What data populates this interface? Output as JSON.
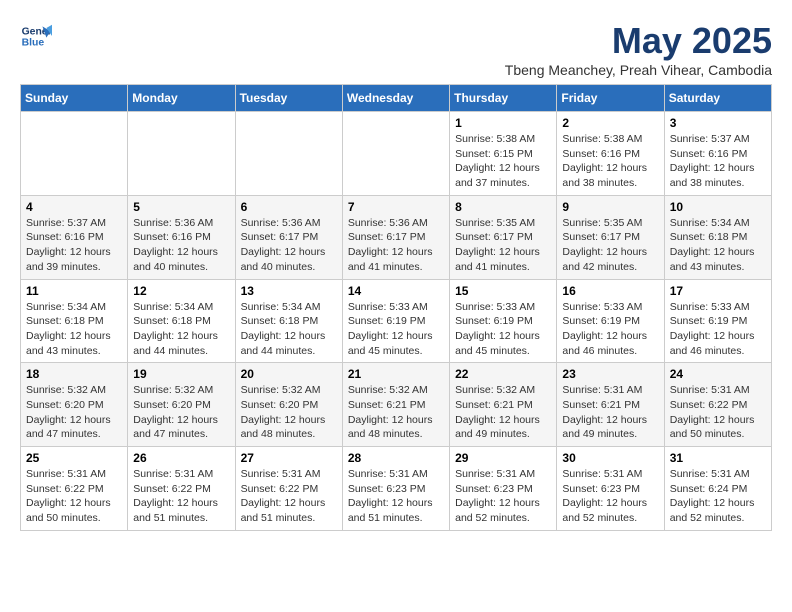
{
  "header": {
    "logo_line1": "General",
    "logo_line2": "Blue",
    "month_title": "May 2025",
    "subtitle": "Tbeng Meanchey, Preah Vihear, Cambodia"
  },
  "days_of_week": [
    "Sunday",
    "Monday",
    "Tuesday",
    "Wednesday",
    "Thursday",
    "Friday",
    "Saturday"
  ],
  "weeks": [
    [
      {
        "day": "",
        "info": ""
      },
      {
        "day": "",
        "info": ""
      },
      {
        "day": "",
        "info": ""
      },
      {
        "day": "",
        "info": ""
      },
      {
        "day": "1",
        "info": "Sunrise: 5:38 AM\nSunset: 6:15 PM\nDaylight: 12 hours\nand 37 minutes."
      },
      {
        "day": "2",
        "info": "Sunrise: 5:38 AM\nSunset: 6:16 PM\nDaylight: 12 hours\nand 38 minutes."
      },
      {
        "day": "3",
        "info": "Sunrise: 5:37 AM\nSunset: 6:16 PM\nDaylight: 12 hours\nand 38 minutes."
      }
    ],
    [
      {
        "day": "4",
        "info": "Sunrise: 5:37 AM\nSunset: 6:16 PM\nDaylight: 12 hours\nand 39 minutes."
      },
      {
        "day": "5",
        "info": "Sunrise: 5:36 AM\nSunset: 6:16 PM\nDaylight: 12 hours\nand 40 minutes."
      },
      {
        "day": "6",
        "info": "Sunrise: 5:36 AM\nSunset: 6:17 PM\nDaylight: 12 hours\nand 40 minutes."
      },
      {
        "day": "7",
        "info": "Sunrise: 5:36 AM\nSunset: 6:17 PM\nDaylight: 12 hours\nand 41 minutes."
      },
      {
        "day": "8",
        "info": "Sunrise: 5:35 AM\nSunset: 6:17 PM\nDaylight: 12 hours\nand 41 minutes."
      },
      {
        "day": "9",
        "info": "Sunrise: 5:35 AM\nSunset: 6:17 PM\nDaylight: 12 hours\nand 42 minutes."
      },
      {
        "day": "10",
        "info": "Sunrise: 5:34 AM\nSunset: 6:18 PM\nDaylight: 12 hours\nand 43 minutes."
      }
    ],
    [
      {
        "day": "11",
        "info": "Sunrise: 5:34 AM\nSunset: 6:18 PM\nDaylight: 12 hours\nand 43 minutes."
      },
      {
        "day": "12",
        "info": "Sunrise: 5:34 AM\nSunset: 6:18 PM\nDaylight: 12 hours\nand 44 minutes."
      },
      {
        "day": "13",
        "info": "Sunrise: 5:34 AM\nSunset: 6:18 PM\nDaylight: 12 hours\nand 44 minutes."
      },
      {
        "day": "14",
        "info": "Sunrise: 5:33 AM\nSunset: 6:19 PM\nDaylight: 12 hours\nand 45 minutes."
      },
      {
        "day": "15",
        "info": "Sunrise: 5:33 AM\nSunset: 6:19 PM\nDaylight: 12 hours\nand 45 minutes."
      },
      {
        "day": "16",
        "info": "Sunrise: 5:33 AM\nSunset: 6:19 PM\nDaylight: 12 hours\nand 46 minutes."
      },
      {
        "day": "17",
        "info": "Sunrise: 5:33 AM\nSunset: 6:19 PM\nDaylight: 12 hours\nand 46 minutes."
      }
    ],
    [
      {
        "day": "18",
        "info": "Sunrise: 5:32 AM\nSunset: 6:20 PM\nDaylight: 12 hours\nand 47 minutes."
      },
      {
        "day": "19",
        "info": "Sunrise: 5:32 AM\nSunset: 6:20 PM\nDaylight: 12 hours\nand 47 minutes."
      },
      {
        "day": "20",
        "info": "Sunrise: 5:32 AM\nSunset: 6:20 PM\nDaylight: 12 hours\nand 48 minutes."
      },
      {
        "day": "21",
        "info": "Sunrise: 5:32 AM\nSunset: 6:21 PM\nDaylight: 12 hours\nand 48 minutes."
      },
      {
        "day": "22",
        "info": "Sunrise: 5:32 AM\nSunset: 6:21 PM\nDaylight: 12 hours\nand 49 minutes."
      },
      {
        "day": "23",
        "info": "Sunrise: 5:31 AM\nSunset: 6:21 PM\nDaylight: 12 hours\nand 49 minutes."
      },
      {
        "day": "24",
        "info": "Sunrise: 5:31 AM\nSunset: 6:22 PM\nDaylight: 12 hours\nand 50 minutes."
      }
    ],
    [
      {
        "day": "25",
        "info": "Sunrise: 5:31 AM\nSunset: 6:22 PM\nDaylight: 12 hours\nand 50 minutes."
      },
      {
        "day": "26",
        "info": "Sunrise: 5:31 AM\nSunset: 6:22 PM\nDaylight: 12 hours\nand 51 minutes."
      },
      {
        "day": "27",
        "info": "Sunrise: 5:31 AM\nSunset: 6:22 PM\nDaylight: 12 hours\nand 51 minutes."
      },
      {
        "day": "28",
        "info": "Sunrise: 5:31 AM\nSunset: 6:23 PM\nDaylight: 12 hours\nand 51 minutes."
      },
      {
        "day": "29",
        "info": "Sunrise: 5:31 AM\nSunset: 6:23 PM\nDaylight: 12 hours\nand 52 minutes."
      },
      {
        "day": "30",
        "info": "Sunrise: 5:31 AM\nSunset: 6:23 PM\nDaylight: 12 hours\nand 52 minutes."
      },
      {
        "day": "31",
        "info": "Sunrise: 5:31 AM\nSunset: 6:24 PM\nDaylight: 12 hours\nand 52 minutes."
      }
    ]
  ]
}
